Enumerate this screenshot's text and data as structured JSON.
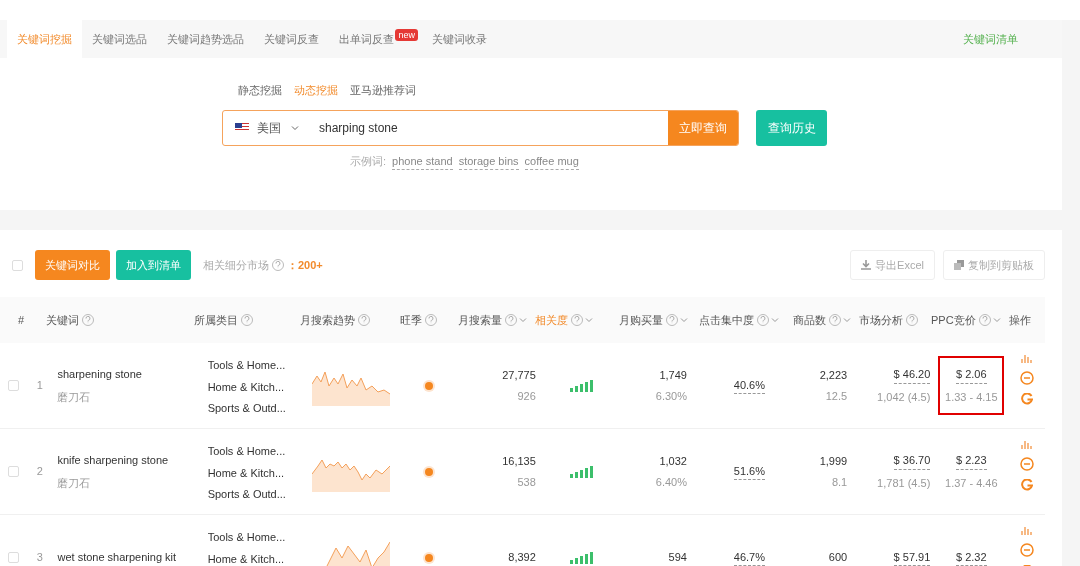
{
  "tabs": [
    {
      "label": "关键词挖掘",
      "selected": true
    },
    {
      "label": "关键词选品",
      "selected": false
    },
    {
      "label": "关键词趋势选品",
      "selected": false
    },
    {
      "label": "关键词反查",
      "selected": false
    },
    {
      "label": "出单词反查",
      "selected": false,
      "badge": "new"
    },
    {
      "label": "关键词收录",
      "selected": false
    }
  ],
  "tabs_right_link": "关键词清单",
  "search": {
    "modes": [
      {
        "label": "静态挖掘",
        "selected": false
      },
      {
        "label": "动态挖掘",
        "selected": true
      },
      {
        "label": "亚马逊推荐词",
        "selected": false
      }
    ],
    "country": "美国",
    "value": "sharping stone",
    "submit": "立即查询",
    "history": "查询历史",
    "examples_label": "示例词:",
    "examples": [
      "phone stand",
      "storage bins",
      "coffee mug"
    ]
  },
  "toolbar": {
    "compare": "关键词对比",
    "add_to_list": "加入到清单",
    "market_label": "相关细分市场",
    "market_sep": "：",
    "market_count": "200+",
    "select_all_checked": false,
    "export": "导出Excel",
    "copy": "复制到剪贴板"
  },
  "table": {
    "columns": [
      {
        "label": "#",
        "kind": "plain",
        "selected": false
      },
      {
        "label": "关键词",
        "kind": "help",
        "selected": false
      },
      {
        "label": "所属类目",
        "kind": "help",
        "selected": false
      },
      {
        "label": "月搜索趋势",
        "kind": "help",
        "selected": false
      },
      {
        "label": "旺季",
        "kind": "help",
        "selected": false
      },
      {
        "label": "月搜索量",
        "kind": "help_sort",
        "selected": false
      },
      {
        "label": "相关度",
        "kind": "help_sort",
        "selected": true
      },
      {
        "label": "月购买量",
        "kind": "help_sort",
        "selected": false
      },
      {
        "label": "点击集中度",
        "kind": "help_sort",
        "selected": false
      },
      {
        "label": "商品数",
        "kind": "help_sort",
        "selected": false
      },
      {
        "label": "市场分析",
        "kind": "help",
        "selected": false
      },
      {
        "label": "PPC竞价",
        "kind": "help_sort",
        "selected": false
      },
      {
        "label": "操作",
        "kind": "plain",
        "selected": false
      }
    ],
    "rows": [
      {
        "checked": false,
        "index": "1",
        "keyword": "sharpening stone",
        "translation": "磨刀石",
        "categories": [
          "Tools & Home...",
          "Home & Kitch...",
          "Sports & Outd..."
        ],
        "search": "27,775",
        "search_sub": "926",
        "purchases": "1,749",
        "purchases_sub": "6.30%",
        "click": "40.6%",
        "products": "2,223",
        "products_sub": "12.5",
        "market": "$ 46.20",
        "market_sub": "1,042 (4.5)",
        "ppc": "$ 2.06",
        "ppc_sub": "1.33 - 4.15",
        "highlighted": true
      },
      {
        "checked": false,
        "index": "2",
        "keyword": "knife sharpening stone",
        "translation": "磨刀石",
        "categories": [
          "Tools & Home...",
          "Home & Kitch...",
          "Sports & Outd..."
        ],
        "search": "16,135",
        "search_sub": "538",
        "purchases": "1,032",
        "purchases_sub": "6.40%",
        "click": "51.6%",
        "products": "1,999",
        "products_sub": "8.1",
        "market": "$ 36.70",
        "market_sub": "1,781 (4.5)",
        "ppc": "$ 2.23",
        "ppc_sub": "1.37 - 4.46",
        "highlighted": false
      },
      {
        "checked": false,
        "index": "3",
        "keyword": "wet stone sharpening kit",
        "categories": [
          "Tools & Home...",
          "Home & Kitch..."
        ],
        "search": "8,392",
        "purchases": "594",
        "click": "46.7%",
        "products": "600",
        "market": "$ 57.91",
        "ppc": "$ 2.32",
        "highlighted": false
      }
    ]
  }
}
